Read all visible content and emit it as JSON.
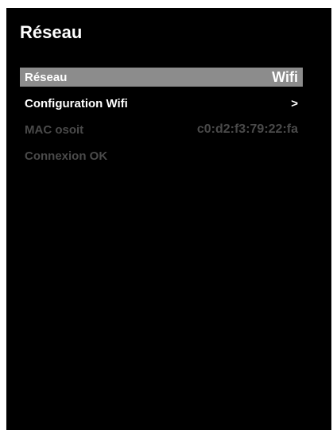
{
  "screen": {
    "title": "Réseau"
  },
  "menu": {
    "items": [
      {
        "label": "Réseau",
        "value": "Wifi"
      },
      {
        "label": "Configuration Wifi",
        "value": ">"
      },
      {
        "label": "MAC osoit",
        "value": "c0:d2:f3:79:22:fa"
      },
      {
        "label": "Connexion OK",
        "value": ""
      }
    ]
  },
  "colors": {
    "background": "#000000",
    "highlight": "#8c8c8c",
    "text": "#ffffff",
    "disabled_text": "#4a4a4a"
  }
}
